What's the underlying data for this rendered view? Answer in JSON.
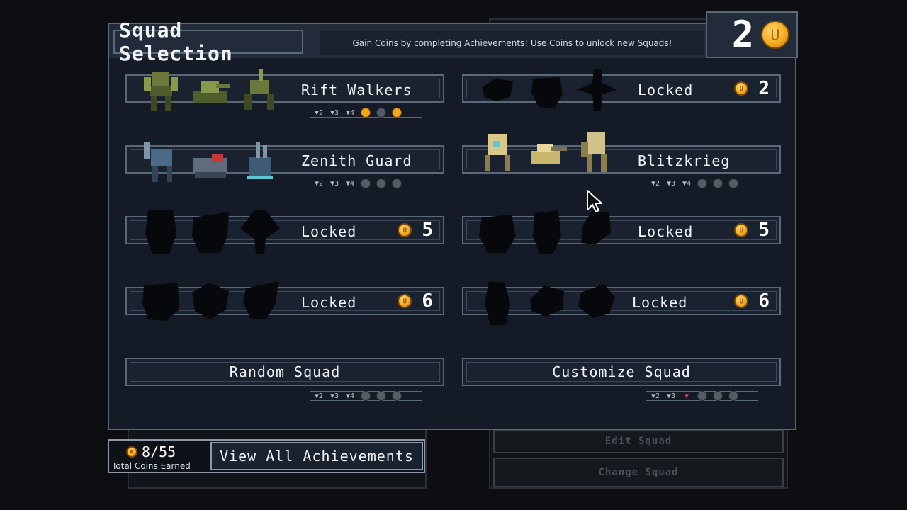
{
  "header": {
    "title": "Squad Selection",
    "subtitle": "Gain Coins by completing Achievements! Use Coins to unlock new Squads!",
    "coins": "2"
  },
  "squads": [
    {
      "name": "Rift Walkers",
      "cost": "",
      "locked": false
    },
    {
      "name": "Locked",
      "cost": "2",
      "locked": true
    },
    {
      "name": "Zenith Guard",
      "cost": "",
      "locked": false
    },
    {
      "name": "Blitzkrieg",
      "cost": "",
      "locked": false
    },
    {
      "name": "Locked",
      "cost": "5",
      "locked": true
    },
    {
      "name": "Locked",
      "cost": "5",
      "locked": true
    },
    {
      "name": "Locked",
      "cost": "6",
      "locked": true
    },
    {
      "name": "Locked",
      "cost": "6",
      "locked": true
    }
  ],
  "trophy_labels": [
    "2",
    "3",
    "4"
  ],
  "buttons": {
    "random": "Random Squad",
    "customize": "Customize Squad",
    "view_achievements": "View All Achievements"
  },
  "footer": {
    "coins_earned": "8/55",
    "coins_label": "Total Coins Earned"
  },
  "background": {
    "edit_squad": "Edit Squad",
    "change_squad": "Change Squad"
  },
  "colors": {
    "panel": "#141b27",
    "border": "#5b6878",
    "coin": "#f2a81d"
  }
}
